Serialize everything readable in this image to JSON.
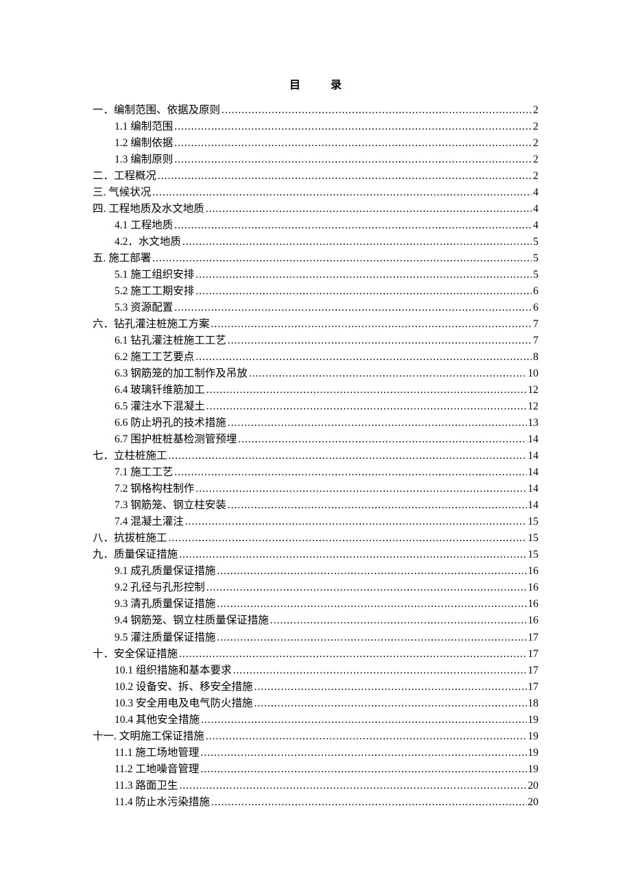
{
  "title": "目 录",
  "entries": [
    {
      "level": 1,
      "label": "一．编制范围、依据及原则",
      "page": "2"
    },
    {
      "level": 2,
      "label": "1.1 编制范围",
      "page": "2"
    },
    {
      "level": 2,
      "label": "1.2 编制依据",
      "page": "2"
    },
    {
      "level": 2,
      "label": "1.3 编制原则",
      "page": "2"
    },
    {
      "level": 1,
      "label": "二．工程概况",
      "page": "2"
    },
    {
      "level": 1,
      "label": "三. 气候状况",
      "page": "4"
    },
    {
      "level": 1,
      "label": "四. 工程地质及水文地质",
      "page": "4"
    },
    {
      "level": 2,
      "label": "4.1 工程地质",
      "page": "4"
    },
    {
      "level": 2,
      "label": "4.2．水文地质",
      "page": "5"
    },
    {
      "level": 1,
      "label": "五. 施工部署",
      "page": "5"
    },
    {
      "level": 2,
      "label": "5.1 施工组织安排",
      "page": "5"
    },
    {
      "level": 2,
      "label": "5.2 施工工期安排",
      "page": "6"
    },
    {
      "level": 2,
      "label": "5.3 资源配置",
      "page": "6"
    },
    {
      "level": 1,
      "label": "六．钻孔灌注桩施工方案",
      "page": "7"
    },
    {
      "level": 2,
      "label": "6.1 钻孔灌注桩施工工艺",
      "page": "7"
    },
    {
      "level": 2,
      "label": "6.2 施工工艺要点",
      "page": "8"
    },
    {
      "level": 2,
      "label": "6.3 钢筋笼的加工制作及吊放",
      "page": "10"
    },
    {
      "level": 2,
      "label": "6.4 玻璃钎维筋加工",
      "page": "12"
    },
    {
      "level": 2,
      "label": "6.5 灌注水下混凝土",
      "page": "12"
    },
    {
      "level": 2,
      "label": "6.6 防止坍孔的技术措施",
      "page": "13"
    },
    {
      "level": 2,
      "label": "6.7 围护桩桩基检测管预埋",
      "page": "14"
    },
    {
      "level": 1,
      "label": "七．立柱桩施工",
      "page": "14"
    },
    {
      "level": 2,
      "label": "7.1 施工工艺",
      "page": "14"
    },
    {
      "level": 2,
      "label": "7.2 钢格构柱制作",
      "page": "14"
    },
    {
      "level": 2,
      "label": "7.3 钢筋笼、钢立柱安装",
      "page": "14"
    },
    {
      "level": 2,
      "label": "7.4 混凝土灌注",
      "page": "15"
    },
    {
      "level": 1,
      "label": "八．抗拔桩施工",
      "page": "15"
    },
    {
      "level": 1,
      "label": "九．质量保证措施",
      "page": "15"
    },
    {
      "level": 2,
      "label": "9.1 成孔质量保证措施",
      "page": "16"
    },
    {
      "level": 2,
      "label": "9.2 孔径与孔形控制",
      "page": "16"
    },
    {
      "level": 2,
      "label": "9.3 清孔质量保证措施",
      "page": "16"
    },
    {
      "level": 2,
      "label": "9.4 钢筋笼、钢立柱质量保证措施",
      "page": "16"
    },
    {
      "level": 2,
      "label": "9.5 灌注质量保证措施",
      "page": "17"
    },
    {
      "level": 1,
      "label": "十．安全保证措施",
      "page": "17"
    },
    {
      "level": 2,
      "label": "10.1 组织措施和基本要求",
      "page": "17"
    },
    {
      "level": 2,
      "label": "10.2 设备安、拆、移安全措施",
      "page": "17"
    },
    {
      "level": 2,
      "label": "10.3 安全用电及电气防火措施",
      "page": "18"
    },
    {
      "level": 2,
      "label": "10.4 其他安全措施",
      "page": "19"
    },
    {
      "level": 1,
      "label": "十一. 文明施工保证措施",
      "page": "19"
    },
    {
      "level": 2,
      "label": "11.1 施工场地管理",
      "page": "19"
    },
    {
      "level": 2,
      "label": "11.2 工地噪音管理",
      "page": "19"
    },
    {
      "level": 2,
      "label": "11.3 路面卫生",
      "page": "20"
    },
    {
      "level": 2,
      "label": "11.4 防止水污染措施",
      "page": "20"
    }
  ]
}
